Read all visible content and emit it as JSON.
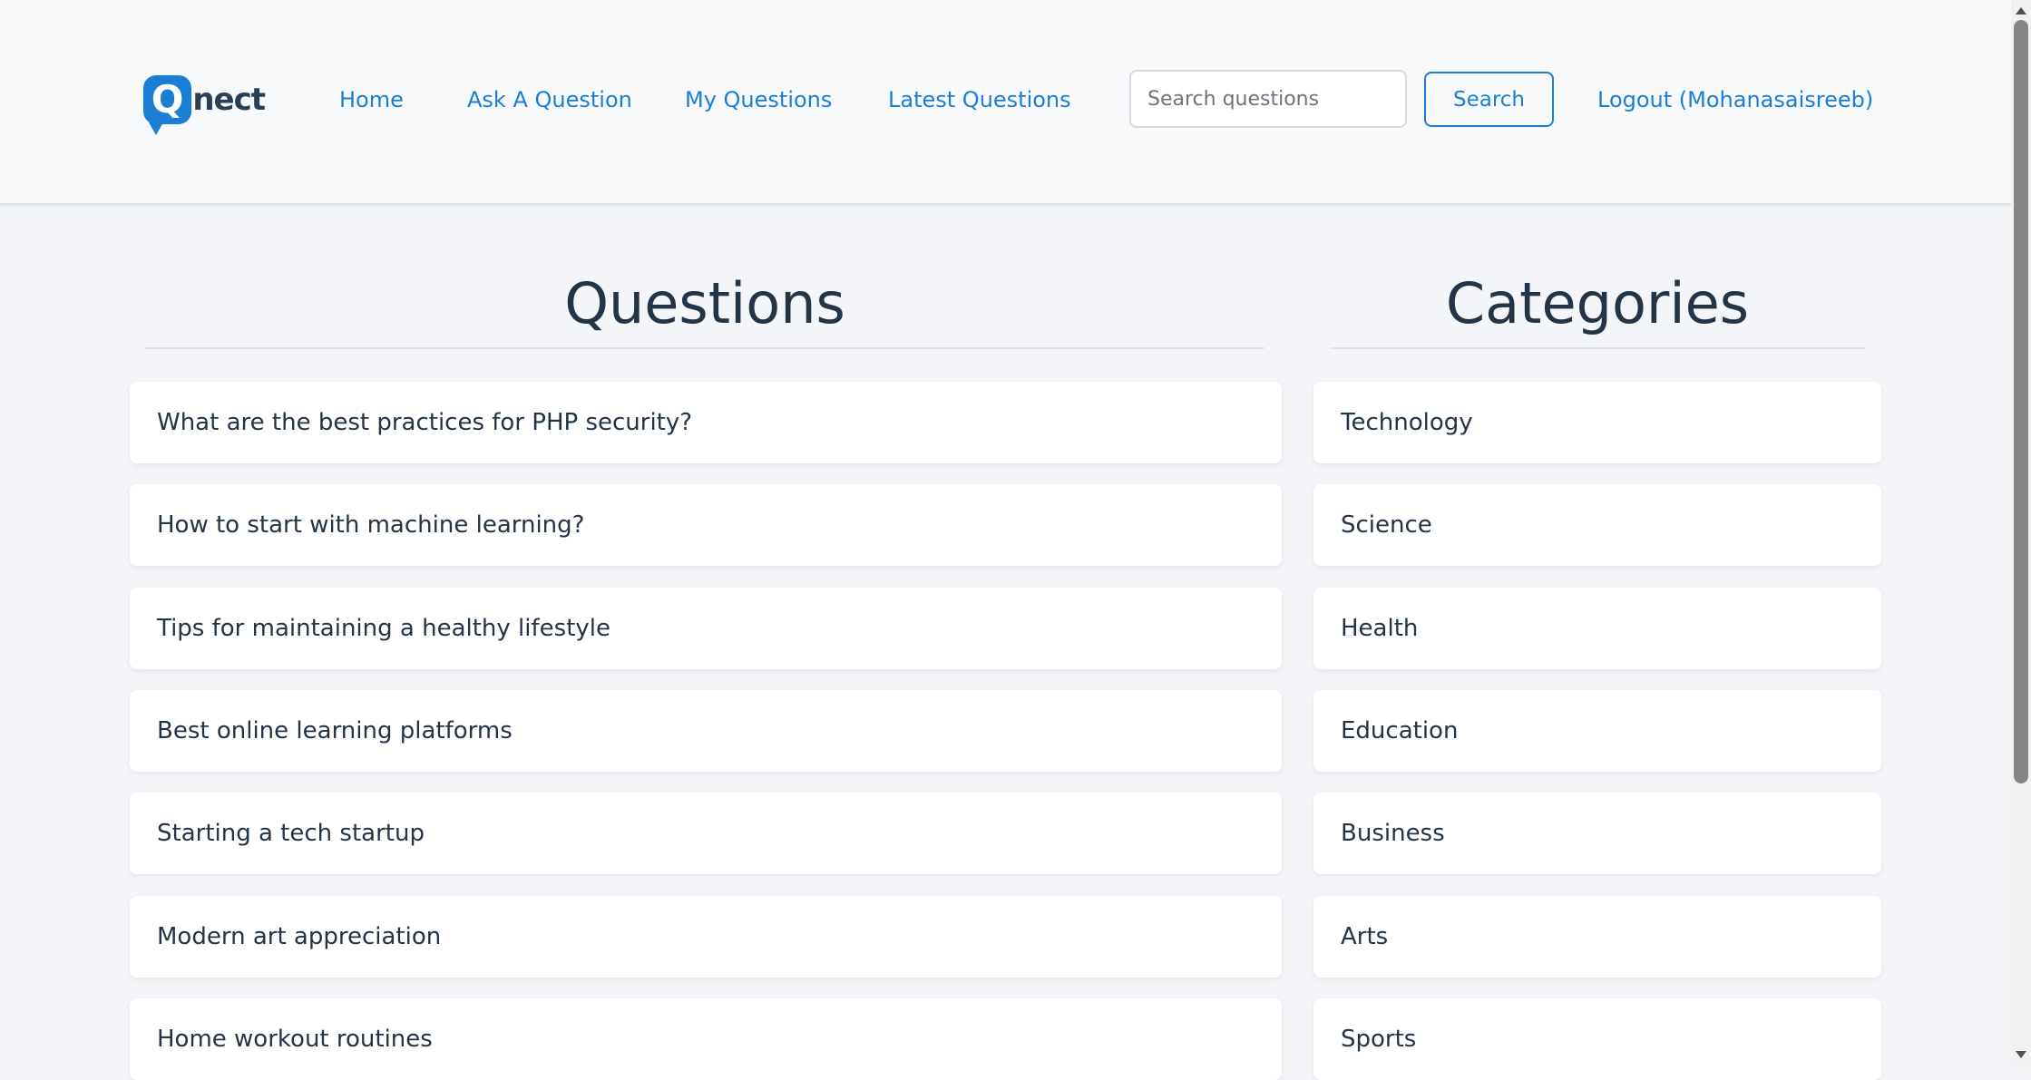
{
  "nav": {
    "logo_text": "nect",
    "logo_letter": "Q",
    "links": [
      "Home",
      "Ask A Question",
      "My Questions",
      "Latest Questions"
    ],
    "search_placeholder": "Search questions",
    "search_button": "Search",
    "logout": "Logout (Mohanasaisreeb)"
  },
  "questions": {
    "title": "Questions",
    "items": [
      "What are the best practices for PHP security?",
      "How to start with machine learning?",
      "Tips for maintaining a healthy lifestyle",
      "Best online learning platforms",
      "Starting a tech startup",
      "Modern art appreciation",
      "Home workout routines"
    ]
  },
  "categories": {
    "title": "Categories",
    "items": [
      "Technology",
      "Science",
      "Health",
      "Education",
      "Business",
      "Arts",
      "Sports"
    ]
  },
  "colors": {
    "accent": "#1a7fd4",
    "text": "#243447",
    "background": "#f3f5f8"
  }
}
